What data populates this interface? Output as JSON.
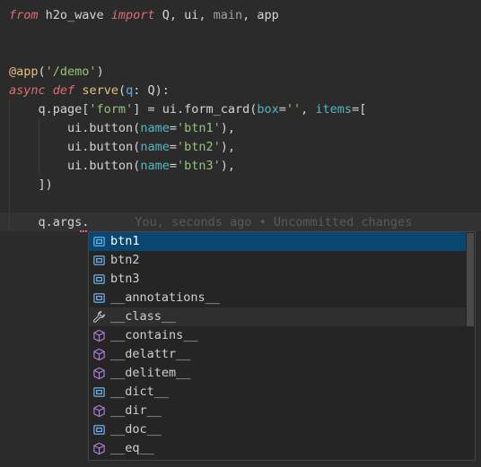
{
  "editor": {
    "top_fragment": "",
    "lines": [
      {
        "id": "l1",
        "segments": [
          {
            "t": "from",
            "c": "kw"
          },
          {
            "t": " h2o_wave ",
            "c": ""
          },
          {
            "t": "import",
            "c": "kw"
          },
          {
            "t": " Q, ui, ",
            "c": ""
          },
          {
            "t": "main",
            "c": "mut"
          },
          {
            "t": ", app",
            "c": ""
          }
        ]
      },
      {
        "id": "l2",
        "segments": []
      },
      {
        "id": "l3",
        "segments": []
      },
      {
        "id": "l4",
        "segments": [
          {
            "t": "@app",
            "c": "dec"
          },
          {
            "t": "(",
            "c": ""
          },
          {
            "t": "'/demo'",
            "c": "str"
          },
          {
            "t": ")",
            "c": ""
          }
        ]
      },
      {
        "id": "l5",
        "segments": [
          {
            "t": "async",
            "c": "kw"
          },
          {
            "t": " ",
            "c": ""
          },
          {
            "t": "def",
            "c": "kw"
          },
          {
            "t": " ",
            "c": ""
          },
          {
            "t": "serve",
            "c": "fn"
          },
          {
            "t": "(",
            "c": ""
          },
          {
            "t": "q",
            "c": "par"
          },
          {
            "t": ": Q):",
            "c": ""
          }
        ]
      },
      {
        "id": "l6",
        "segments": [
          {
            "t": "    q.page[",
            "c": ""
          },
          {
            "t": "'form'",
            "c": "str"
          },
          {
            "t": "] = ui.form_card(",
            "c": ""
          },
          {
            "t": "box",
            "c": "arg"
          },
          {
            "t": "=",
            "c": ""
          },
          {
            "t": "''",
            "c": "str"
          },
          {
            "t": ", ",
            "c": ""
          },
          {
            "t": "items",
            "c": "arg"
          },
          {
            "t": "=[",
            "c": ""
          }
        ]
      },
      {
        "id": "l7",
        "segments": [
          {
            "t": "        ui.button(",
            "c": ""
          },
          {
            "t": "name",
            "c": "arg"
          },
          {
            "t": "=",
            "c": ""
          },
          {
            "t": "'btn1'",
            "c": "str"
          },
          {
            "t": "),",
            "c": ""
          }
        ]
      },
      {
        "id": "l8",
        "segments": [
          {
            "t": "        ui.button(",
            "c": ""
          },
          {
            "t": "name",
            "c": "arg"
          },
          {
            "t": "=",
            "c": ""
          },
          {
            "t": "'btn2'",
            "c": "str"
          },
          {
            "t": "),",
            "c": ""
          }
        ]
      },
      {
        "id": "l9",
        "segments": [
          {
            "t": "        ui.button(",
            "c": ""
          },
          {
            "t": "name",
            "c": "arg"
          },
          {
            "t": "=",
            "c": ""
          },
          {
            "t": "'btn3'",
            "c": "str"
          },
          {
            "t": "),",
            "c": ""
          }
        ]
      },
      {
        "id": "l10",
        "segments": [
          {
            "t": "    ])",
            "c": ""
          }
        ]
      },
      {
        "id": "l11",
        "segments": []
      },
      {
        "id": "l12",
        "segments": [
          {
            "t": "    q.args.",
            "c": ""
          }
        ]
      }
    ],
    "blame_text": "You, seconds ago • Uncommitted changes"
  },
  "suggest": {
    "items": [
      {
        "label": "btn1",
        "icon": "field-icon",
        "state": "selected"
      },
      {
        "label": "btn2",
        "icon": "field-icon",
        "state": ""
      },
      {
        "label": "btn3",
        "icon": "field-icon",
        "state": ""
      },
      {
        "label": "__annotations__",
        "icon": "field-icon",
        "state": ""
      },
      {
        "label": "__class__",
        "icon": "wrench-icon",
        "state": "hover"
      },
      {
        "label": "__contains__",
        "icon": "method-cube-icon",
        "state": ""
      },
      {
        "label": "__delattr__",
        "icon": "method-cube-icon",
        "state": ""
      },
      {
        "label": "__delitem__",
        "icon": "method-cube-icon",
        "state": ""
      },
      {
        "label": "__dict__",
        "icon": "field-icon",
        "state": ""
      },
      {
        "label": "__dir__",
        "icon": "method-cube-icon",
        "state": ""
      },
      {
        "label": "__doc__",
        "icon": "field-icon",
        "state": ""
      },
      {
        "label": "__eq__",
        "icon": "method-cube-icon",
        "state": ""
      }
    ]
  },
  "colors": {
    "background": "#2b2b2b",
    "selected_row": "#094771",
    "field_icon": "#75beff",
    "method_icon": "#b180d7"
  }
}
